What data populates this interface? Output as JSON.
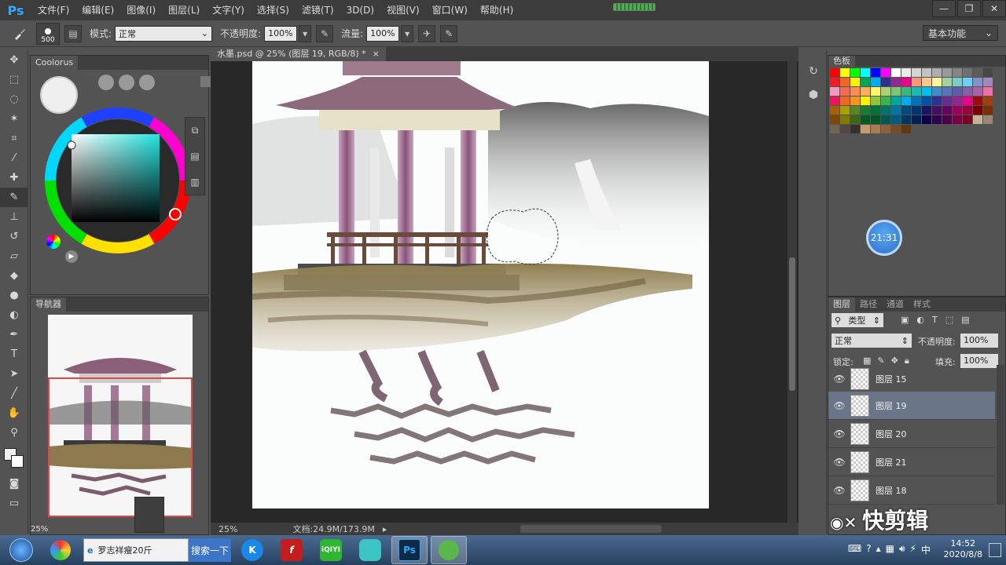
{
  "app": {
    "logo": "Ps"
  },
  "menu": [
    "文件(F)",
    "编辑(E)",
    "图像(I)",
    "图层(L)",
    "文字(Y)",
    "选择(S)",
    "滤镜(T)",
    "3D(D)",
    "视图(V)",
    "窗口(W)",
    "帮助(H)"
  ],
  "window_controls": {
    "minimize": "—",
    "restore": "❐",
    "close": "✕"
  },
  "options": {
    "brush_size": "500",
    "mode_label": "模式:",
    "mode_value": "正常",
    "opacity_label": "不透明度:",
    "opacity_value": "100%",
    "flow_label": "流量:",
    "flow_value": "100%",
    "workspace": "基本功能"
  },
  "coolorus": {
    "title": "Coolorus"
  },
  "navigator": {
    "title": "导航器",
    "zoom": "25%"
  },
  "document": {
    "tab_title": "水墨.psd @ 25% (图层 19, RGB/8) *",
    "close": "×"
  },
  "status": {
    "zoom": "25%",
    "doc_info": "文档:24.9M/173.9M"
  },
  "swatches": {
    "title": "色板",
    "colors": [
      "#ff0000",
      "#ffff00",
      "#00ff00",
      "#00ffff",
      "#0000ff",
      "#ff00ff",
      "#ffffff",
      "#ebebeb",
      "#d6d6d6",
      "#c2c2c2",
      "#adadad",
      "#999999",
      "#858585",
      "#707070",
      "#5c5c5c",
      "#474747",
      "#ee1d24",
      "#f26522",
      "#fff200",
      "#00a651",
      "#00aeef",
      "#2e3192",
      "#92278f",
      "#ec008c",
      "#f7977a",
      "#fdc689",
      "#fff79a",
      "#a3d39c",
      "#7accc8",
      "#6dcff6",
      "#8393ca",
      "#a187be",
      "#f49ac1",
      "#f26c4f",
      "#f68e56",
      "#fbaf5d",
      "#fff568",
      "#acd373",
      "#7cc576",
      "#3bb878",
      "#1abbb4",
      "#00bff3",
      "#438cca",
      "#5574b9",
      "#605ca8",
      "#855fa8",
      "#a763a8",
      "#f06ea9",
      "#ed145b",
      "#f26522",
      "#f7941d",
      "#fff200",
      "#8dc73f",
      "#39b54a",
      "#00a99d",
      "#00aeef",
      "#0072bc",
      "#0054a6",
      "#2e3192",
      "#662d91",
      "#92278f",
      "#ec008c",
      "#9e0b0f",
      "#a0410d",
      "#a3620a",
      "#aba000",
      "#598527",
      "#197b30",
      "#007236",
      "#00746b",
      "#0076a3",
      "#004a80",
      "#003471",
      "#1b1464",
      "#440e62",
      "#630460",
      "#9e005d",
      "#9e0039",
      "#790000",
      "#7b2e00",
      "#7d4900",
      "#827b00",
      "#406618",
      "#005e20",
      "#005826",
      "#005952",
      "#005b7f",
      "#003663",
      "#002157",
      "#0d004c",
      "#32004b",
      "#4b0049",
      "#7b0046",
      "#7a0026",
      "#c7b299",
      "#998675",
      "#736357",
      "#534741",
      "#37302a",
      "#c69c6d",
      "#a67c52",
      "#8c6239",
      "#754c24",
      "#603913"
    ]
  },
  "layers": {
    "tabs": [
      "图层",
      "路径",
      "通道",
      "样式"
    ],
    "filter": "类型",
    "blend_mode": "正常",
    "opacity_label": "不透明度:",
    "opacity_value": "100%",
    "lock_label": "锁定:",
    "fill_label": "填充:",
    "fill_value": "100%",
    "items": [
      {
        "name": "图层 15",
        "selected": false
      },
      {
        "name": "图层 19",
        "selected": true
      },
      {
        "name": "图层 20",
        "selected": false
      },
      {
        "name": "图层 21",
        "selected": false
      },
      {
        "name": "图层 18",
        "selected": false
      }
    ]
  },
  "overlay": {
    "timer": "21:31",
    "watermark": "快剪辑"
  },
  "taskbar": {
    "search_text": "罗志祥瘦20斤",
    "search_button": "搜索一下",
    "time": "14:52",
    "date": "2020/8/8"
  }
}
